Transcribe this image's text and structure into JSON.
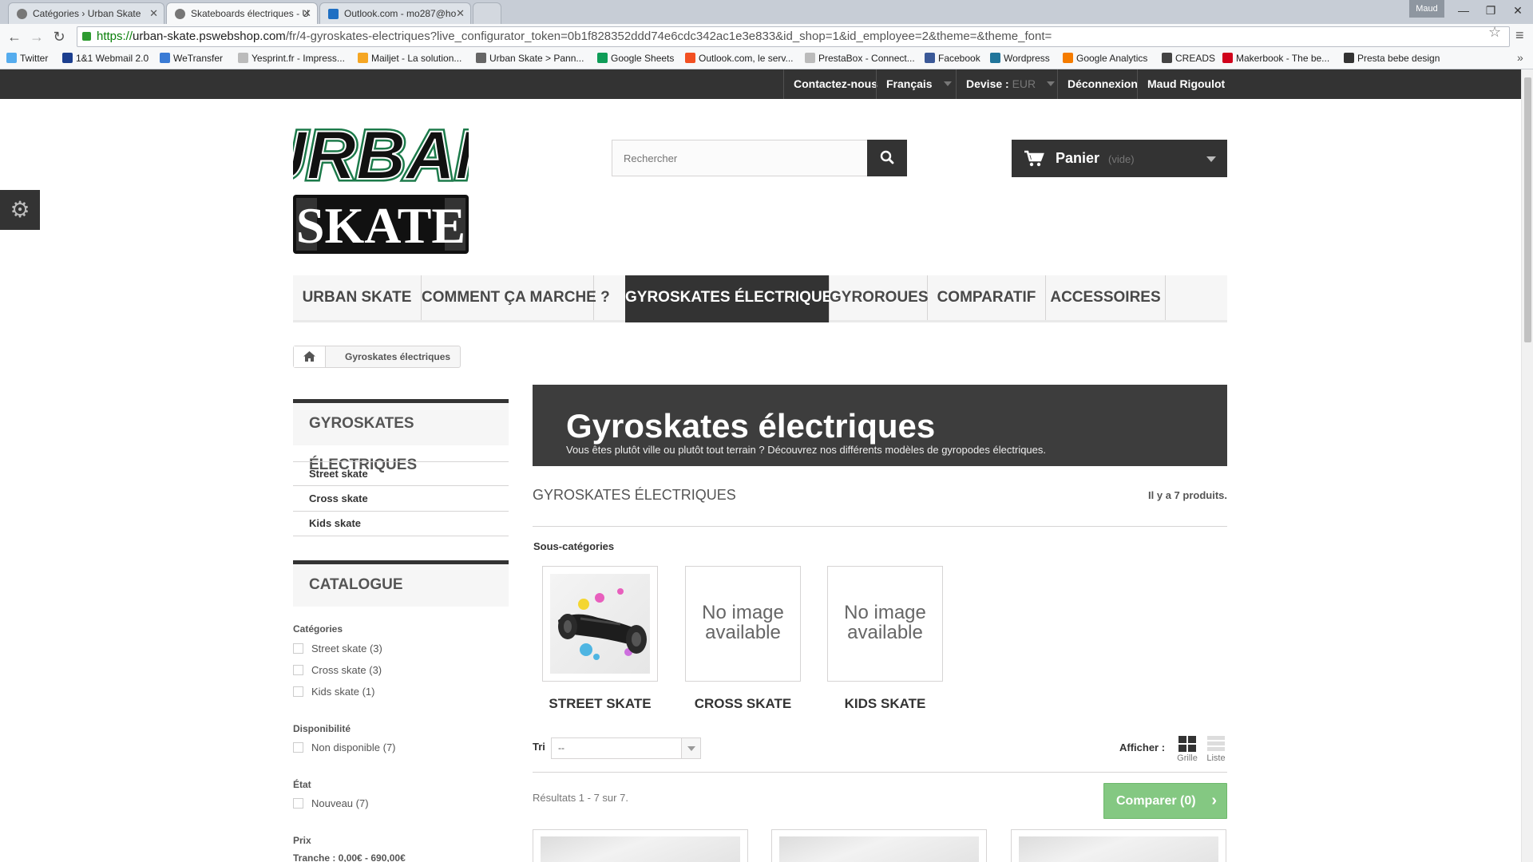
{
  "browser": {
    "tabs": [
      {
        "title": "Catégories › Urban Skate"
      },
      {
        "title": "Skateboards électriques - U"
      },
      {
        "title": "Outlook.com - mo287@ho"
      }
    ],
    "user": "Maud",
    "url": {
      "protocol": "https://",
      "host": "urban-skate.pswebshop.com",
      "path": "/fr/4-gyroskates-electriques?live_configurator_token=0b1f828352ddd74e6cdc342ac1e3e833&id_shop=1&id_employee=2&theme=&theme_font="
    },
    "bookmarks": [
      {
        "label": "Twitter",
        "icon": "twitter-icon",
        "color": "#55acee"
      },
      {
        "label": "1&1 Webmail 2.0",
        "icon": "webmail-icon",
        "color": "#1c3f8f"
      },
      {
        "label": "WeTransfer",
        "icon": "wetransfer-icon",
        "color": "#3a7bd5"
      },
      {
        "label": "Yesprint.fr - Impress...",
        "icon": "page-icon",
        "color": "#bbbbbb"
      },
      {
        "label": "Mailjet - La solution...",
        "icon": "mailjet-icon",
        "color": "#f5a623"
      },
      {
        "label": "Urban Skate > Pann...",
        "icon": "urbanskate-icon",
        "color": "#666666"
      },
      {
        "label": "Google Sheets",
        "icon": "sheets-icon",
        "color": "#0f9d58"
      },
      {
        "label": "Outlook.com, le serv...",
        "icon": "windows-icon",
        "color": "#f25022"
      },
      {
        "label": "PrestaBox - Connect...",
        "icon": "page-icon",
        "color": "#bbbbbb"
      },
      {
        "label": "Facebook",
        "icon": "facebook-icon",
        "color": "#3b5998"
      },
      {
        "label": "Wordpress",
        "icon": "wordpress-icon",
        "color": "#21759b"
      },
      {
        "label": "Google Analytics",
        "icon": "analytics-icon",
        "color": "#f57c00"
      },
      {
        "label": "CREADS",
        "icon": "creads-icon",
        "color": "#444444"
      },
      {
        "label": "Makerbook - The be...",
        "icon": "makerbook-icon",
        "color": "#d0021b"
      },
      {
        "label": "Presta bebe design",
        "icon": "presta-icon",
        "color": "#333333"
      }
    ]
  },
  "topbar": {
    "contact": "Contactez-nous",
    "language": "Français",
    "currency_label": "Devise :",
    "currency_value": "EUR",
    "logout": "Déconnexion",
    "user": "Maud Rigoulot"
  },
  "header": {
    "logo_text_top": "URBAN",
    "logo_text_bottom": "SKATE",
    "search_placeholder": "Rechercher",
    "cart_label": "Panier",
    "cart_status": "(vide)"
  },
  "menu": [
    {
      "label": "URBAN SKATE",
      "active": false
    },
    {
      "label": "COMMENT ÇA MARCHE ?",
      "active": false
    },
    {
      "label": "GYROSKATES ÉLECTRIQUES",
      "active": true
    },
    {
      "label": "GYROROUES",
      "active": false
    },
    {
      "label": "COMPARATIF",
      "active": false
    },
    {
      "label": "ACCESSOIRES",
      "active": false
    }
  ],
  "breadcrumb": {
    "current": "Gyroskates électriques"
  },
  "left": {
    "category_block_title": "GYROSKATES ÉLECTRIQUES",
    "category_links": [
      "Street skate",
      "Cross skate",
      "Kids skate"
    ],
    "catalog_title": "CATALOGUE",
    "facets": [
      {
        "title": "Catégories",
        "options": [
          "Street skate (3)",
          "Cross skate (3)",
          "Kids skate (1)"
        ]
      },
      {
        "title": "Disponibilité",
        "options": [
          "Non disponible (7)"
        ]
      },
      {
        "title": "État",
        "options": [
          "Nouveau (7)"
        ]
      },
      {
        "title": "Prix",
        "options": [
          "Tranche : 0,00€ - 690,00€"
        ]
      }
    ]
  },
  "category": {
    "title": "Gyroskates électriques",
    "description": "Vous êtes plutôt ville ou plutôt tout terrain ? Découvrez nos différents modèles de gyropodes électriques.",
    "heading": "GYROSKATES ÉLECTRIQUES",
    "product_count": "Il y a 7 produits.",
    "subcategories_title": "Sous-catégories",
    "subcategories": [
      {
        "name": "STREET SKATE",
        "has_image": true
      },
      {
        "name": "CROSS SKATE",
        "has_image": false,
        "placeholder": "No image available"
      },
      {
        "name": "KIDS SKATE",
        "has_image": false,
        "placeholder": "No image available"
      }
    ]
  },
  "listing": {
    "sort_label": "Tri",
    "sort_value": "--",
    "display_label": "Afficher :",
    "grid_label": "Grille",
    "list_label": "Liste",
    "results": "Résultats 1 - 7 sur 7.",
    "compare_label": "Comparer (0)"
  }
}
